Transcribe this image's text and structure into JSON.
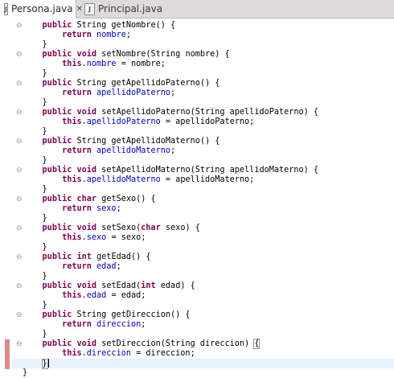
{
  "tabs": [
    {
      "label": "Persona.java",
      "close": "✕",
      "active": true
    },
    {
      "label": "Principal.java",
      "active": false
    }
  ],
  "code_lines": [
    {
      "fold": true,
      "segs": [
        [
          "",
          "    "
        ],
        [
          "kw",
          "public"
        ],
        [
          "",
          " String getNombre() {"
        ]
      ]
    },
    {
      "fold": false,
      "segs": [
        [
          "",
          "        "
        ],
        [
          "kw",
          "return"
        ],
        [
          "",
          " "
        ],
        [
          "fld",
          "nombre"
        ],
        [
          "",
          ";"
        ]
      ]
    },
    {
      "fold": false,
      "segs": [
        [
          "",
          "    }"
        ]
      ]
    },
    {
      "fold": true,
      "segs": [
        [
          "",
          "    "
        ],
        [
          "kw",
          "public"
        ],
        [
          "",
          " "
        ],
        [
          "kw",
          "void"
        ],
        [
          "",
          " setNombre(String nombre) {"
        ]
      ]
    },
    {
      "fold": false,
      "segs": [
        [
          "",
          "        "
        ],
        [
          "kw",
          "this"
        ],
        [
          "",
          "."
        ],
        [
          "fld",
          "nombre"
        ],
        [
          "",
          " = nombre;"
        ]
      ]
    },
    {
      "fold": false,
      "segs": [
        [
          "",
          "    }"
        ]
      ]
    },
    {
      "fold": true,
      "segs": [
        [
          "",
          "    "
        ],
        [
          "kw",
          "public"
        ],
        [
          "",
          " String getApellidoPaterno() {"
        ]
      ]
    },
    {
      "fold": false,
      "segs": [
        [
          "",
          "        "
        ],
        [
          "kw",
          "return"
        ],
        [
          "",
          " "
        ],
        [
          "fld",
          "apellidoPaterno"
        ],
        [
          "",
          ";"
        ]
      ]
    },
    {
      "fold": false,
      "segs": [
        [
          "",
          "    }"
        ]
      ]
    },
    {
      "fold": true,
      "segs": [
        [
          "",
          "    "
        ],
        [
          "kw",
          "public"
        ],
        [
          "",
          " "
        ],
        [
          "kw",
          "void"
        ],
        [
          "",
          " setApellidoPaterno(String apellidoPaterno) {"
        ]
      ]
    },
    {
      "fold": false,
      "segs": [
        [
          "",
          "        "
        ],
        [
          "kw",
          "this"
        ],
        [
          "",
          "."
        ],
        [
          "fld",
          "apellidoPaterno"
        ],
        [
          "",
          " = apellidoPaterno;"
        ]
      ]
    },
    {
      "fold": false,
      "segs": [
        [
          "",
          "    }"
        ]
      ]
    },
    {
      "fold": true,
      "segs": [
        [
          "",
          "    "
        ],
        [
          "kw",
          "public"
        ],
        [
          "",
          " String getApellidoMaterno() {"
        ]
      ]
    },
    {
      "fold": false,
      "segs": [
        [
          "",
          "        "
        ],
        [
          "kw",
          "return"
        ],
        [
          "",
          " "
        ],
        [
          "fld",
          "apellidoMaterno"
        ],
        [
          "",
          ";"
        ]
      ]
    },
    {
      "fold": false,
      "segs": [
        [
          "",
          "    }"
        ]
      ]
    },
    {
      "fold": true,
      "segs": [
        [
          "",
          "    "
        ],
        [
          "kw",
          "public"
        ],
        [
          "",
          " "
        ],
        [
          "kw",
          "void"
        ],
        [
          "",
          " setApellidoMaterno(String apellidoMaterno) {"
        ]
      ]
    },
    {
      "fold": false,
      "segs": [
        [
          "",
          "        "
        ],
        [
          "kw",
          "this"
        ],
        [
          "",
          "."
        ],
        [
          "fld",
          "apellidoMaterno"
        ],
        [
          "",
          " = apellidoMaterno;"
        ]
      ]
    },
    {
      "fold": false,
      "segs": [
        [
          "",
          "    }"
        ]
      ]
    },
    {
      "fold": true,
      "segs": [
        [
          "",
          "    "
        ],
        [
          "kw",
          "public"
        ],
        [
          "",
          " "
        ],
        [
          "kw",
          "char"
        ],
        [
          "",
          " getSexo() {"
        ]
      ]
    },
    {
      "fold": false,
      "segs": [
        [
          "",
          "        "
        ],
        [
          "kw",
          "return"
        ],
        [
          "",
          " "
        ],
        [
          "fld",
          "sexo"
        ],
        [
          "",
          ";"
        ]
      ]
    },
    {
      "fold": false,
      "segs": [
        [
          "",
          "    }"
        ]
      ]
    },
    {
      "fold": true,
      "segs": [
        [
          "",
          "    "
        ],
        [
          "kw",
          "public"
        ],
        [
          "",
          " "
        ],
        [
          "kw",
          "void"
        ],
        [
          "",
          " setSexo("
        ],
        [
          "kw",
          "char"
        ],
        [
          "",
          " sexo) {"
        ]
      ]
    },
    {
      "fold": false,
      "segs": [
        [
          "",
          "        "
        ],
        [
          "kw",
          "this"
        ],
        [
          "",
          "."
        ],
        [
          "fld",
          "sexo"
        ],
        [
          "",
          " = sexo;"
        ]
      ]
    },
    {
      "fold": false,
      "segs": [
        [
          "",
          "    }"
        ]
      ]
    },
    {
      "fold": true,
      "segs": [
        [
          "",
          "    "
        ],
        [
          "kw",
          "public"
        ],
        [
          "",
          " "
        ],
        [
          "kw",
          "int"
        ],
        [
          "",
          " getEdad() {"
        ]
      ]
    },
    {
      "fold": false,
      "segs": [
        [
          "",
          "        "
        ],
        [
          "kw",
          "return"
        ],
        [
          "",
          " "
        ],
        [
          "fld",
          "edad"
        ],
        [
          "",
          ";"
        ]
      ]
    },
    {
      "fold": false,
      "segs": [
        [
          "",
          "    }"
        ]
      ]
    },
    {
      "fold": true,
      "segs": [
        [
          "",
          "    "
        ],
        [
          "kw",
          "public"
        ],
        [
          "",
          " "
        ],
        [
          "kw",
          "void"
        ],
        [
          "",
          " setEdad("
        ],
        [
          "kw",
          "int"
        ],
        [
          "",
          " edad) {"
        ]
      ]
    },
    {
      "fold": false,
      "segs": [
        [
          "",
          "        "
        ],
        [
          "kw",
          "this"
        ],
        [
          "",
          "."
        ],
        [
          "fld",
          "edad"
        ],
        [
          "",
          " = edad;"
        ]
      ]
    },
    {
      "fold": false,
      "segs": [
        [
          "",
          "    }"
        ]
      ]
    },
    {
      "fold": true,
      "segs": [
        [
          "",
          "    "
        ],
        [
          "kw",
          "public"
        ],
        [
          "",
          " String getDireccion() {"
        ]
      ]
    },
    {
      "fold": false,
      "segs": [
        [
          "",
          "        "
        ],
        [
          "kw",
          "return"
        ],
        [
          "",
          " "
        ],
        [
          "fld",
          "direccion"
        ],
        [
          "",
          ";"
        ]
      ]
    },
    {
      "fold": false,
      "segs": [
        [
          "",
          "    }"
        ]
      ]
    },
    {
      "fold": true,
      "segs": [
        [
          "",
          "    "
        ],
        [
          "kw",
          "public"
        ],
        [
          "",
          " "
        ],
        [
          "kw",
          "void"
        ],
        [
          "",
          " setDireccion(String direccion) "
        ],
        [
          "bracket",
          "{"
        ]
      ]
    },
    {
      "fold": false,
      "segs": [
        [
          "",
          "        "
        ],
        [
          "kw",
          "this"
        ],
        [
          "",
          "."
        ],
        [
          "fld",
          "direccion"
        ],
        [
          "",
          " = direccion;"
        ]
      ]
    },
    {
      "fold": false,
      "current": true,
      "segs": [
        [
          "",
          "    "
        ],
        [
          "bracket",
          "}"
        ],
        [
          "caret",
          ""
        ]
      ]
    },
    {
      "fold": false,
      "segs": [
        [
          "",
          "}"
        ]
      ]
    }
  ],
  "change_markers": [
    33,
    34,
    35
  ],
  "colors": {
    "keyword": "#7f0055",
    "field": "#0000c0",
    "marker": "#e08a8a",
    "current_line": "#e8f2fe"
  },
  "icons": {
    "tab_file": "java-file-icon",
    "tab_close": "close-icon",
    "fold": "fold-collapse-icon"
  }
}
